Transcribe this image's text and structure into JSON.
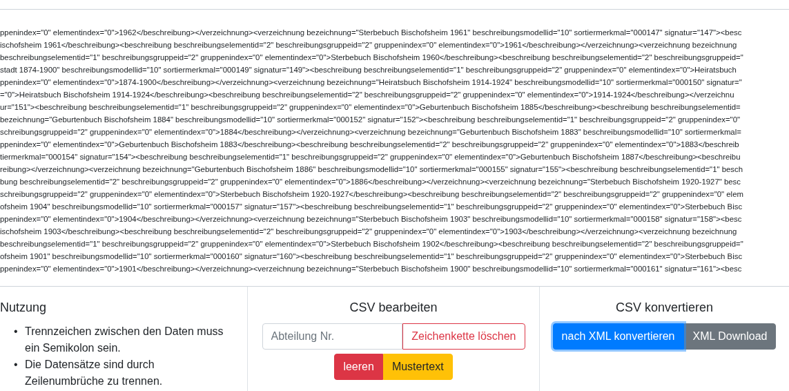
{
  "xml_output": {
    "lines": [
      "ppenindex=\"0\" elementindex=\"0\">1962</beschreibung></verzeichnung><verzeichnung bezeichnung=\"Sterbebuch Bischofsheim 1961\" beschreibungsmodellid=\"10\" sortiermerkmal=\"000147\" signatur=\"147\"><besc",
      "ischofsheim 1961</beschreibung><beschreibung beschreibungselementid=\"2\" beschreibungsgruppeid=\"2\" gruppenindex=\"0\" elementindex=\"0\">1961</beschreibung></verzeichnung><verzeichnung bezeichnung",
      "beschreibungselementid=\"1\" beschreibungsgruppeid=\"2\" gruppenindex=\"0\" elementindex=\"0\">Sterbebuch Bischofsheim 1960</beschreibung><beschreibung beschreibungselementid=\"2\" beschreibungsgruppeid=\"",
      "stadt 1874-1900\" beschreibungsmodellid=\"10\" sortiermerkmal=\"000149\" signatur=\"149\"><beschreibung beschreibungselementid=\"1\" beschreibungsgruppeid=\"2\" gruppenindex=\"0\" elementindex=\"0\">Heiratsbuch",
      "ppenindex=\"0\" elementindex=\"0\">1874-1900</beschreibung></verzeichnung><verzeichnung bezeichnung=\"Heiratsbuch Bischofsheim 1914-1924\" beschreibungsmodellid=\"10\" sortiermerkmal=\"000150\" signatur=\"",
      "=\"0\">Heiratsbuch Bischofsheim 1914-1924</beschreibung><beschreibung beschreibungselementid=\"2\" beschreibungsgruppeid=\"2\" gruppenindex=\"0\" elementindex=\"0\">1914-1924</beschreibung></verzeichnu",
      "ur=\"151\"><beschreibung beschreibungselementid=\"1\" beschreibungsgruppeid=\"2\" gruppenindex=\"0\" elementindex=\"0\">Geburtenbuch Bischofsheim 1885</beschreibung><beschreibung beschreibungselementid=",
      "bezeichnung=\"Geburtenbuch Bischofsheim 1884\" beschreibungsmodellid=\"10\" sortiermerkmal=\"000152\" signatur=\"152\"><beschreibung beschreibungselementid=\"1\" beschreibungsgruppeid=\"2\" gruppenindex=\"0\"",
      "schreibungsgruppeid=\"2\" gruppenindex=\"0\" elementindex=\"0\">1884</beschreibung></verzeichnung><verzeichnung bezeichnung=\"Geburtenbuch Bischofsheim 1883\" beschreibungsmodellid=\"10\" sortiermerkmal=",
      "ppenindex=\"0\" elementindex=\"0\">Geburtenbuch Bischofsheim 1883</beschreibung><beschreibung beschreibungselementid=\"2\" beschreibungsgruppeid=\"2\" gruppenindex=\"0\" elementindex=\"0\">1883</beschreib",
      "tiermerkmal=\"000154\" signatur=\"154\"><beschreibung beschreibungselementid=\"1\" beschreibungsgruppeid=\"2\" gruppenindex=\"0\" elementindex=\"0\">Geburtenbuch Bischofsheim 1887</beschreibung><beschreibu",
      "reibung></verzeichnung><verzeichnung bezeichnung=\"Geburtenbuch Bischofsheim 1886\" beschreibungsmodellid=\"10\" sortiermerkmal=\"000155\" signatur=\"155\"><beschreibung beschreibungselementid=\"1\" besch",
      "bung beschreibungselementid=\"2\" beschreibungsgruppeid=\"2\" gruppenindex=\"0\" elementindex=\"0\">1886</beschreibung></verzeichnung><verzeichnung bezeichnung=\"Sterbebuch Bischofsheim 1920-1927\" besc",
      "schreibungsgruppeid=\"2\" gruppenindex=\"0\" elementindex=\"0\">Sterbebuch Bischofsheim 1920-1927</beschreibung><beschreibung beschreibungselementid=\"2\" beschreibungsgruppeid=\"2\" gruppenindex=\"0\" elem",
      "ofsheim 1904\" beschreibungsmodellid=\"10\" sortiermerkmal=\"000157\" signatur=\"157\"><beschreibung beschreibungselementid=\"1\" beschreibungsgruppeid=\"2\" gruppenindex=\"0\" elementindex=\"0\">Sterbebuch Bisc",
      "ppenindex=\"0\" elementindex=\"0\">1904</beschreibung></verzeichnung><verzeichnung bezeichnung=\"Sterbebuch Bischofsheim 1903\" beschreibungsmodellid=\"10\" sortiermerkmal=\"000158\" signatur=\"158\"><besc",
      "ischofsheim 1903</beschreibung><beschreibung beschreibungselementid=\"2\" beschreibungsgruppeid=\"2\" gruppenindex=\"0\" elementindex=\"0\">1903</beschreibung></verzeichnung><verzeichnung bezeichnung",
      "beschreibungselementid=\"1\" beschreibungsgruppeid=\"2\" gruppenindex=\"0\" elementindex=\"0\">Sterbebuch Bischofsheim 1902</beschreibung><beschreibung beschreibungselementid=\"2\" beschreibungsgruppeid=\"",
      "ofsheim 1901\" beschreibungsmodellid=\"10\" sortiermerkmal=\"000160\" signatur=\"160\"><beschreibung beschreibungselementid=\"1\" beschreibungsgruppeid=\"2\" gruppenindex=\"0\" elementindex=\"0\">Sterbebuch Bisc",
      "ppenindex=\"0\" elementindex=\"0\">1901</beschreibung></verzeichnung><verzeichnung bezeichnung=\"Sterbebuch Bischofsheim 1900\" beschreibungsmodellid=\"10\" sortiermerkmal=\"000161\" signatur=\"161\"><besc"
    ]
  },
  "usage": {
    "title": "Nutzung",
    "items": [
      {
        "marker": "•",
        "text": "Trennzeichen zwischen den Daten muss ein Semikolon sein."
      },
      {
        "marker": "•",
        "text": "Die Datensätze sind durch Zeilenumbrüche zu trennen."
      }
    ]
  },
  "edit": {
    "title": "CSV bearbeiten",
    "field": {
      "placeholder": "Abteilung Nr."
    },
    "buttons": [
      {
        "label": "Zeichenkette löschen",
        "kind": "outline-danger"
      },
      {
        "label": "leeren",
        "kind": "danger"
      },
      {
        "label": "Mustertext",
        "kind": "warning"
      }
    ]
  },
  "convert": {
    "title": "CSV konvertieren",
    "buttons": [
      {
        "label": "nach XML konvertieren",
        "kind": "primary",
        "focused": true
      },
      {
        "label": "XML Download",
        "kind": "secondary",
        "focused": false
      }
    ]
  }
}
